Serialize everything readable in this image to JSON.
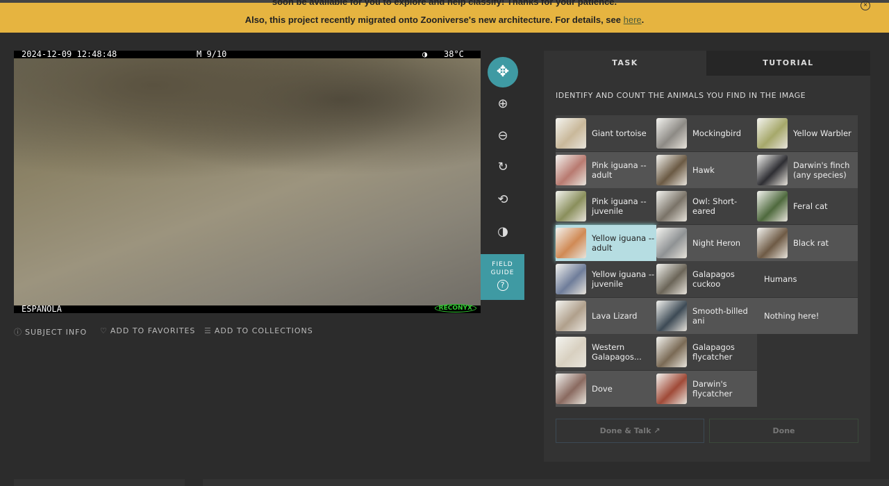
{
  "banner": {
    "line1": "soon be available for you to explore and help classify! Thanks for your patience.",
    "line2_prefix": "Also, this project recently migrated onto Zooniverse's new architecture. For details, see ",
    "link": "here",
    "line2_suffix": ".",
    "close_icon": "×"
  },
  "image": {
    "date": "2024-12-09 12:48:48",
    "frame": "M 9/10",
    "moon": "◑",
    "temp": "38°C",
    "location": "ESPANOLA",
    "brand": "RECONYX"
  },
  "tools": {
    "move": "✥",
    "zoom_in": "⊕",
    "zoom_out": "⊖",
    "rotate": "↻",
    "reset": "⟲",
    "invert": "◑",
    "field_guide": "FIELD GUIDE",
    "help": "?"
  },
  "meta": {
    "subject_info": "SUBJECT INFO",
    "favorites": "ADD TO FAVORITES",
    "collections": "ADD TO COLLECTIONS",
    "info_icon": "ⓘ",
    "heart_icon": "♡",
    "list_icon": "☰"
  },
  "tabs": {
    "task": "TASK",
    "tutorial": "TUTORIAL"
  },
  "instruction": "IDENTIFY AND COUNT THE ANIMALS YOU FIND IN THE IMAGE",
  "choices": [
    {
      "label": "Giant tortoise",
      "color": "#c9b89a"
    },
    {
      "label": "Mockingbird",
      "color": "#8d8a85"
    },
    {
      "label": "Yellow Warbler",
      "color": "#a6a86a"
    },
    {
      "label": "Pink iguana -- adult",
      "color": "#b87a70"
    },
    {
      "label": "Hawk",
      "color": "#6b5a44"
    },
    {
      "label": "Darwin's finch (any species)",
      "color": "#2e2e33"
    },
    {
      "label": "Pink iguana -- juvenile",
      "color": "#8a8f5c"
    },
    {
      "label": "Owl: Short-eared",
      "color": "#7a7368"
    },
    {
      "label": "Feral cat",
      "color": "#4f6a3e"
    },
    {
      "label": "Yellow iguana -- adult",
      "color": "#d08a55",
      "selected": true
    },
    {
      "label": "Night Heron",
      "color": "#8f9294"
    },
    {
      "label": "Black rat",
      "color": "#6e5a45"
    },
    {
      "label": "Yellow iguana -- juvenile",
      "color": "#6f7d9a"
    },
    {
      "label": "Galapagos cuckoo",
      "color": "#6b6558"
    },
    {
      "label": "Humans",
      "nothumb": true
    },
    {
      "label": "Lava Lizard",
      "color": "#b0a08c"
    },
    {
      "label": "Smooth-billed ani",
      "color": "#3d4a55"
    },
    {
      "label": "Nothing here!",
      "nothumb": true
    },
    {
      "label": "Western Galapagos...",
      "color": "#d8d0c0"
    },
    {
      "label": "Galapagos flycatcher",
      "color": "#7a6a55"
    },
    null,
    {
      "label": "Dove",
      "color": "#8a6a60"
    },
    {
      "label": "Darwin's flycatcher",
      "color": "#a04a38"
    },
    null
  ],
  "buttons": {
    "done_talk": "Done & Talk ↗",
    "done": "Done"
  }
}
